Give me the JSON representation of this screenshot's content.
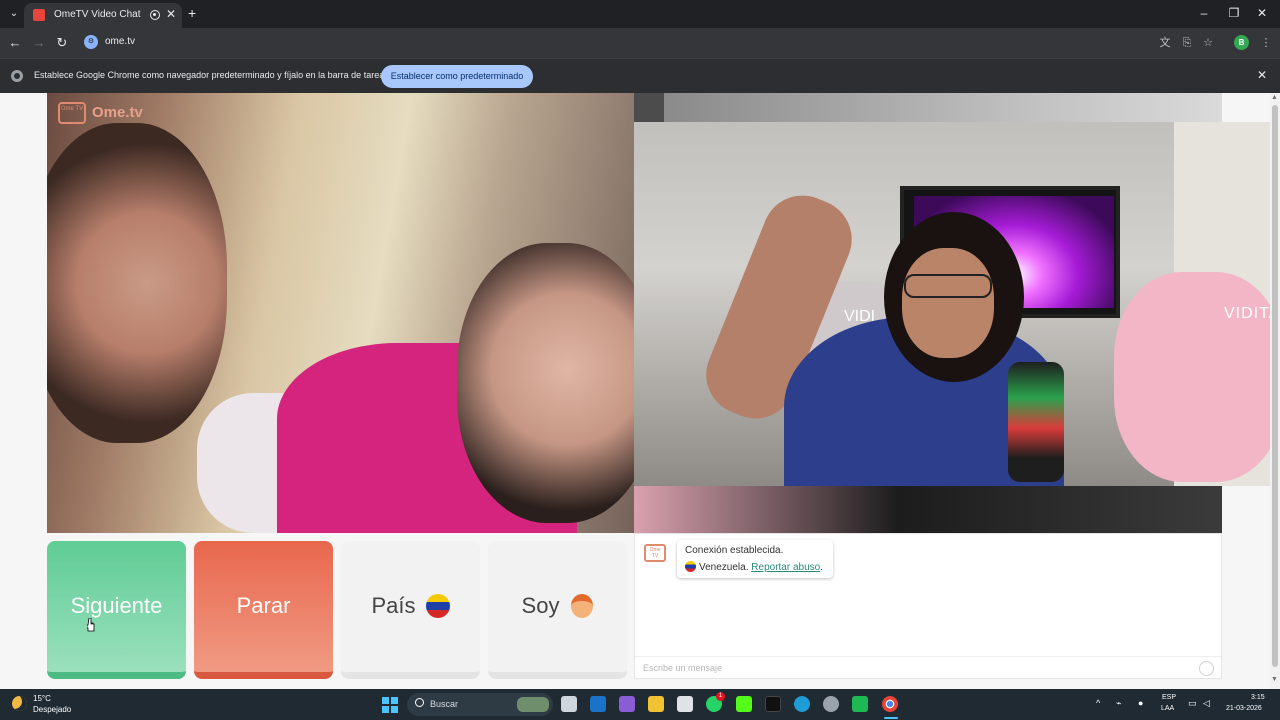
{
  "browser": {
    "tab_title": "OmeTV Video Chat — Ome",
    "url": "ome.tv",
    "profile_initial": "B",
    "infobar_text": "Establece Google Chrome como navegador predeterminado y fíjalo en la barra de tareas",
    "infobar_button": "Establecer como predeterminado",
    "icons": [
      "tab-list-icon",
      "audio-playing-icon",
      "close-icon",
      "new-tab-icon",
      "minimize-icon",
      "maximize-icon",
      "window-close-icon",
      "back-icon",
      "forward-icon",
      "reload-icon",
      "site-info-icon",
      "translate-icon",
      "install-icon",
      "bookmark-star-icon",
      "menu-icon",
      "chrome-icon"
    ]
  },
  "app": {
    "logo_badge": "Ome TV",
    "logo_text": "Ome.tv",
    "pip_overlay_text_left": "VIDI",
    "pip_overlay_text_right": "VIDITA",
    "buttons": {
      "next": "Siguiente",
      "stop": "Parar",
      "country": "País",
      "gender": "Soy"
    },
    "country_flag": "venezuela-flag-icon",
    "gender_icon": "boy-emoji-icon",
    "colors": {
      "next": "#5fcc95",
      "stop": "#e8674d",
      "logo": "#e08a6e",
      "link": "#2a8a7e"
    }
  },
  "chat": {
    "system_line1": "Conexión establecida.",
    "country": "Venezuela.",
    "report_link": "Reportar abuso",
    "report_suffix": ".",
    "input_placeholder": "Escribe un mensaje"
  },
  "taskbar": {
    "temperature": "15°C",
    "weather": "Despejado",
    "search_label": "Buscar",
    "language_line1": "ESP",
    "language_line2": "LAA",
    "time": "3:15",
    "date": "21-03-2026",
    "notification_badge": "1",
    "apps": [
      "task-view",
      "outlook",
      "app-store",
      "file-explorer",
      "microsoft-store",
      "whatsapp",
      "kick",
      "tiktok",
      "edge",
      "openai",
      "app-green",
      "chrome"
    ]
  }
}
